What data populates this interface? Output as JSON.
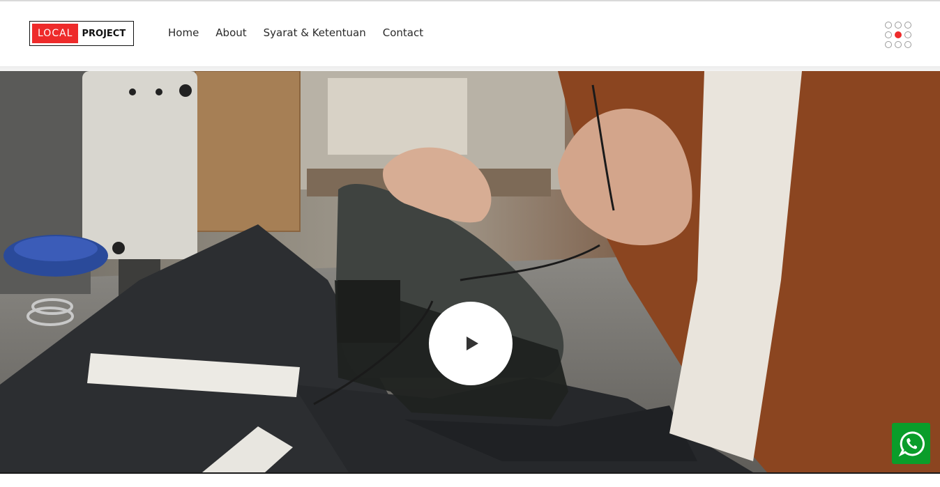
{
  "logo": {
    "part1": "LOCAL",
    "part2": "PROJECT"
  },
  "nav": {
    "items": [
      {
        "label": "Home"
      },
      {
        "label": "About"
      },
      {
        "label": "Syarat & Ketentuan"
      },
      {
        "label": "Contact"
      }
    ]
  },
  "menu": {
    "icon": "dots-grid-icon"
  },
  "hero": {
    "image": "shoemaker-lacing-leather-shoe",
    "play_icon": "play-icon"
  },
  "whatsapp": {
    "icon": "whatsapp-icon"
  },
  "colors": {
    "brand_red": "#ee2b2b",
    "whatsapp_green": "#0a9d2a",
    "text_dark": "#2a2a2a"
  }
}
